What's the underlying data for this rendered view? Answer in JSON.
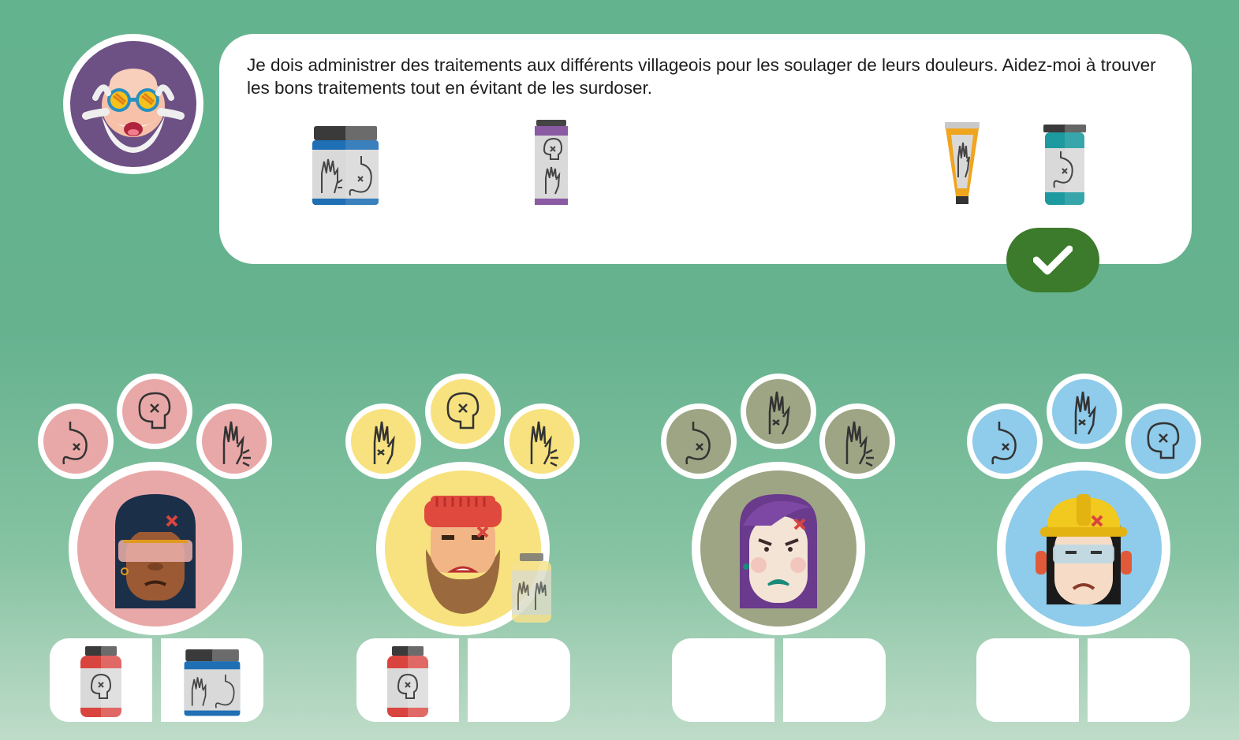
{
  "dialog": {
    "message": "Je dois administrer des traitements aux différents villageois pour les soulager de leurs douleurs. Aidez-moi à trouver les bons traitements tout en évitant de les surdoser."
  },
  "treatments": [
    {
      "name": "blue-jar",
      "color": "#1e6fb4",
      "treats": [
        "hand",
        "stomach"
      ]
    },
    {
      "name": "purple-vial",
      "color": "#8a5aa3",
      "treats": [
        "brain",
        "hand"
      ]
    },
    {
      "name": "yellow-tube",
      "color": "#f0a51f",
      "treats": [
        "hand"
      ]
    },
    {
      "name": "teal-bottle",
      "color": "#1c9aa0",
      "treats": [
        "stomach"
      ]
    }
  ],
  "villagers": [
    {
      "name": "villager-1",
      "color": "#e9a8a8",
      "symptoms": [
        "stomach",
        "brain",
        "hand-joint"
      ],
      "slots": [
        "red-bottle",
        "blue-jar"
      ]
    },
    {
      "name": "villager-2",
      "color": "#f7e27f",
      "symptoms": [
        "hand",
        "brain",
        "hand-joint"
      ],
      "slots": [
        "red-bottle",
        ""
      ],
      "dragging": "yellow-vial"
    },
    {
      "name": "villager-3",
      "color": "#9ea584",
      "symptoms": [
        "stomach",
        "hand",
        "hand-joint"
      ],
      "slots": [
        "",
        ""
      ]
    },
    {
      "name": "villager-4",
      "color": "#8fcbea",
      "symptoms": [
        "stomach",
        "hand",
        "brain"
      ],
      "slots": [
        "",
        ""
      ]
    }
  ],
  "colors": {
    "background": "#66b28f",
    "confirm": "#3c7a2c",
    "red_bottle": "#d9443f"
  }
}
